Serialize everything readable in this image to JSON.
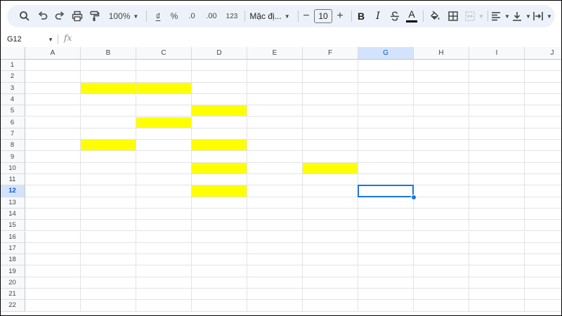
{
  "toolbar": {
    "zoom": "100%",
    "currency_symbol": "₫",
    "percent_symbol": "%",
    "decrease_decimal": ".0",
    "increase_decimal": ".00",
    "more_formats": "123",
    "font_family": "Mặc đị...",
    "font_size": "10",
    "bold": "B",
    "italic": "I",
    "text_color_letter": "A"
  },
  "formula_bar": {
    "name_box": "G12",
    "fx_label": "fx",
    "formula": ""
  },
  "sheet": {
    "columns": [
      "A",
      "B",
      "C",
      "D",
      "E",
      "F",
      "G",
      "H",
      "I",
      "J"
    ],
    "rows": [
      "1",
      "2",
      "3",
      "4",
      "5",
      "6",
      "7",
      "8",
      "9",
      "10",
      "11",
      "12",
      "13",
      "14",
      "15",
      "16",
      "17",
      "18",
      "19",
      "20",
      "21",
      "22"
    ],
    "selected_column": "G",
    "selected_row": "12",
    "active_cell": "G12",
    "fill_color": "#FFFF00",
    "filled_cells": [
      "B3",
      "C3",
      "D5",
      "C6",
      "B8",
      "D8",
      "D10",
      "F10",
      "D12"
    ]
  },
  "colors": {
    "toolbar_bg": "#EDF2FA",
    "selection_blue": "#1A73E8",
    "header_selected_bg": "#D3E3FD"
  }
}
